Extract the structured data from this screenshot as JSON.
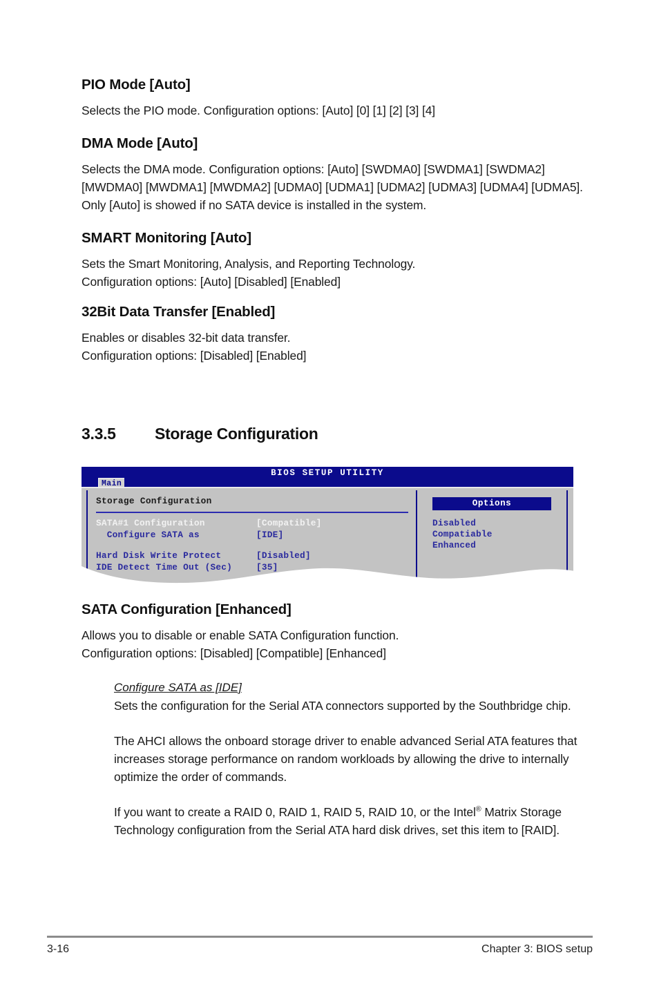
{
  "page": {
    "footer_page_number": "3-16",
    "footer_chapter": "Chapter 3: BIOS setup"
  },
  "items": [
    {
      "heading": "PIO Mode [Auto]",
      "paragraphs": [
        "Selects the PIO mode. Configuration options: [Auto] [0] [1] [2] [3] [4]"
      ]
    },
    {
      "heading": "DMA Mode [Auto]",
      "paragraphs": [
        "Selects the DMA mode. Configuration options: [Auto] [SWDMA0] [SWDMA1] [SWDMA2] [MWDMA0] [MWDMA1] [MWDMA2] [UDMA0] [UDMA1] [UDMA2] [UDMA3] [UDMA4] [UDMA5]. Only [Auto] is showed if no SATA device is installed in the system."
      ]
    },
    {
      "heading": "SMART Monitoring [Auto]",
      "paragraphs": [
        "Sets the Smart Monitoring, Analysis, and Reporting Technology.",
        "Configuration options: [Auto] [Disabled] [Enabled]"
      ]
    },
    {
      "heading": "32Bit Data Transfer [Enabled]",
      "paragraphs": [
        "Enables or disables 32-bit data transfer.",
        "Configuration options: [Disabled] [Enabled]"
      ]
    }
  ],
  "section": {
    "number": "3.3.5",
    "title": "Storage Configuration"
  },
  "bios": {
    "title": "BIOS SETUP UTILITY",
    "tab": "Main",
    "panel_title": "Storage Configuration",
    "rows": [
      {
        "label": "SATA#1 Configuration",
        "value": "[Compatible]",
        "selected": true
      },
      {
        "label": "  Configure SATA as",
        "value": "[IDE]",
        "selected": false
      },
      {
        "label": "Hard Disk Write Protect",
        "value": "[Disabled]",
        "selected": false
      },
      {
        "label": "IDE Detect Time Out (Sec)",
        "value": "[35]",
        "selected": false
      }
    ],
    "options_header": "Options",
    "options": [
      "Disabled",
      "Compatiable",
      "Enhanced"
    ],
    "colors": {
      "titlebar": "#0b0b8c",
      "panel_bg": "#c3c3c3",
      "text_blue": "#2b2b9e",
      "selected_text": "#f2f2f2"
    }
  },
  "sata": {
    "heading": "SATA Configuration [Enhanced]",
    "paragraphs": [
      "Allows you to disable or enable SATA Configuration function.",
      "Configuration options: [Disabled] [Compatible] [Enhanced]"
    ],
    "sub_heading": "Configure SATA as [IDE]",
    "sub_paragraph_1": "Sets the configuration for the Serial ATA connectors supported by the Southbridge chip.",
    "sub_paragraph_2": "The AHCI allows the onboard storage driver to enable advanced Serial ATA features that increases storage performance on random workloads by allowing the drive to internally optimize the order of commands.",
    "sub_paragraph_3_pre": "If you want to create a RAID 0, RAID 1,  RAID 5,  RAID 10, or the Intel",
    "sub_paragraph_3_post": " Matrix Storage Technology configuration from the Serial ATA hard disk drives, set this item to [RAID]."
  }
}
